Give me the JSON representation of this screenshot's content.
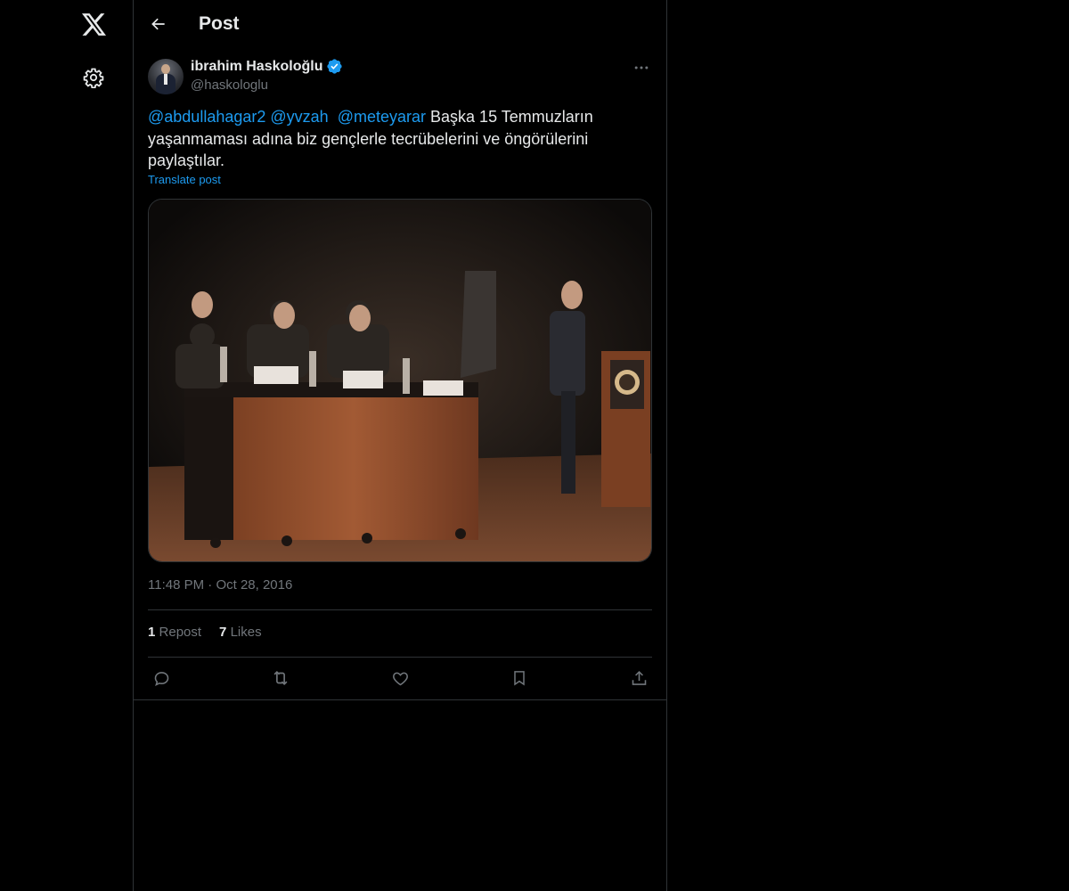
{
  "nav": {
    "logo_icon": "x-logo-icon",
    "settings_icon": "gear-icon"
  },
  "header": {
    "title": "Post",
    "back_icon": "arrow-left-icon"
  },
  "author": {
    "name": "ibrahim Haskoloğlu",
    "handle": "@haskologlu",
    "verified": true,
    "verified_color": "#1d9bf0"
  },
  "tweet": {
    "mentions": [
      "@abdullahagar2",
      "@yvzah",
      "@meteyarar"
    ],
    "body": "Başka 15 Temmuzların yaşanmaması adına biz gençlerle tecrübelerini ve öngörülerini paylaştılar.",
    "translate_label": "Translate post",
    "time": "11:48 PM",
    "separator": "·",
    "date": "Oct 28, 2016"
  },
  "stats": {
    "reposts_count": "1",
    "reposts_label": "Repost",
    "likes_count": "7",
    "likes_label": "Likes"
  },
  "actions": [
    {
      "name": "reply",
      "icon": "reply-icon"
    },
    {
      "name": "repost",
      "icon": "repost-icon"
    },
    {
      "name": "like",
      "icon": "heart-icon"
    },
    {
      "name": "bookmark",
      "icon": "bookmark-icon"
    },
    {
      "name": "share",
      "icon": "share-icon"
    }
  ],
  "colors": {
    "background": "#000000",
    "text": "#e7e9ea",
    "secondary": "#71767b",
    "accent": "#1d9bf0",
    "border": "#2f3336"
  }
}
